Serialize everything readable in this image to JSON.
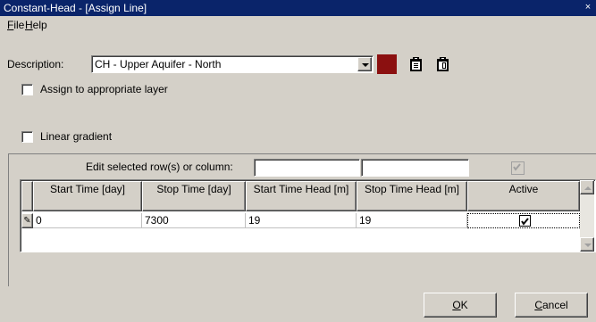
{
  "window": {
    "title": "Constant-Head - [Assign Line]",
    "close_glyph": "×"
  },
  "menu": [
    {
      "accel": "F",
      "rest": "ile"
    },
    {
      "accel": "H",
      "rest": "elp"
    }
  ],
  "description": {
    "label": "Description:",
    "value": "CH - Upper Aquifer - North",
    "color": "#8b1010"
  },
  "icons": {
    "copy": "clipboard-copy-icon",
    "paste": "clipboard-paste-icon"
  },
  "assign_layer": {
    "label": "Assign to appropriate layer",
    "checked": false
  },
  "linear_gradient": {
    "label": "Linear gradient",
    "checked": false
  },
  "edit_row": {
    "label": "Edit selected row(s) or column:",
    "field1": "",
    "field2": "",
    "active_checked": true
  },
  "table": {
    "columns": [
      "Start Time [day]",
      "Stop Time [day]",
      "Start Time Head [m]",
      "Stop Time Head [m]",
      "Active"
    ],
    "rows": [
      {
        "indicator": "✎",
        "start_time": "0",
        "stop_time": "7300",
        "start_head": "19",
        "stop_head": "19",
        "active": true
      }
    ]
  },
  "buttons": {
    "ok": {
      "accel": "O",
      "rest": "K"
    },
    "cancel": {
      "accel": "C",
      "rest": "ancel"
    }
  }
}
